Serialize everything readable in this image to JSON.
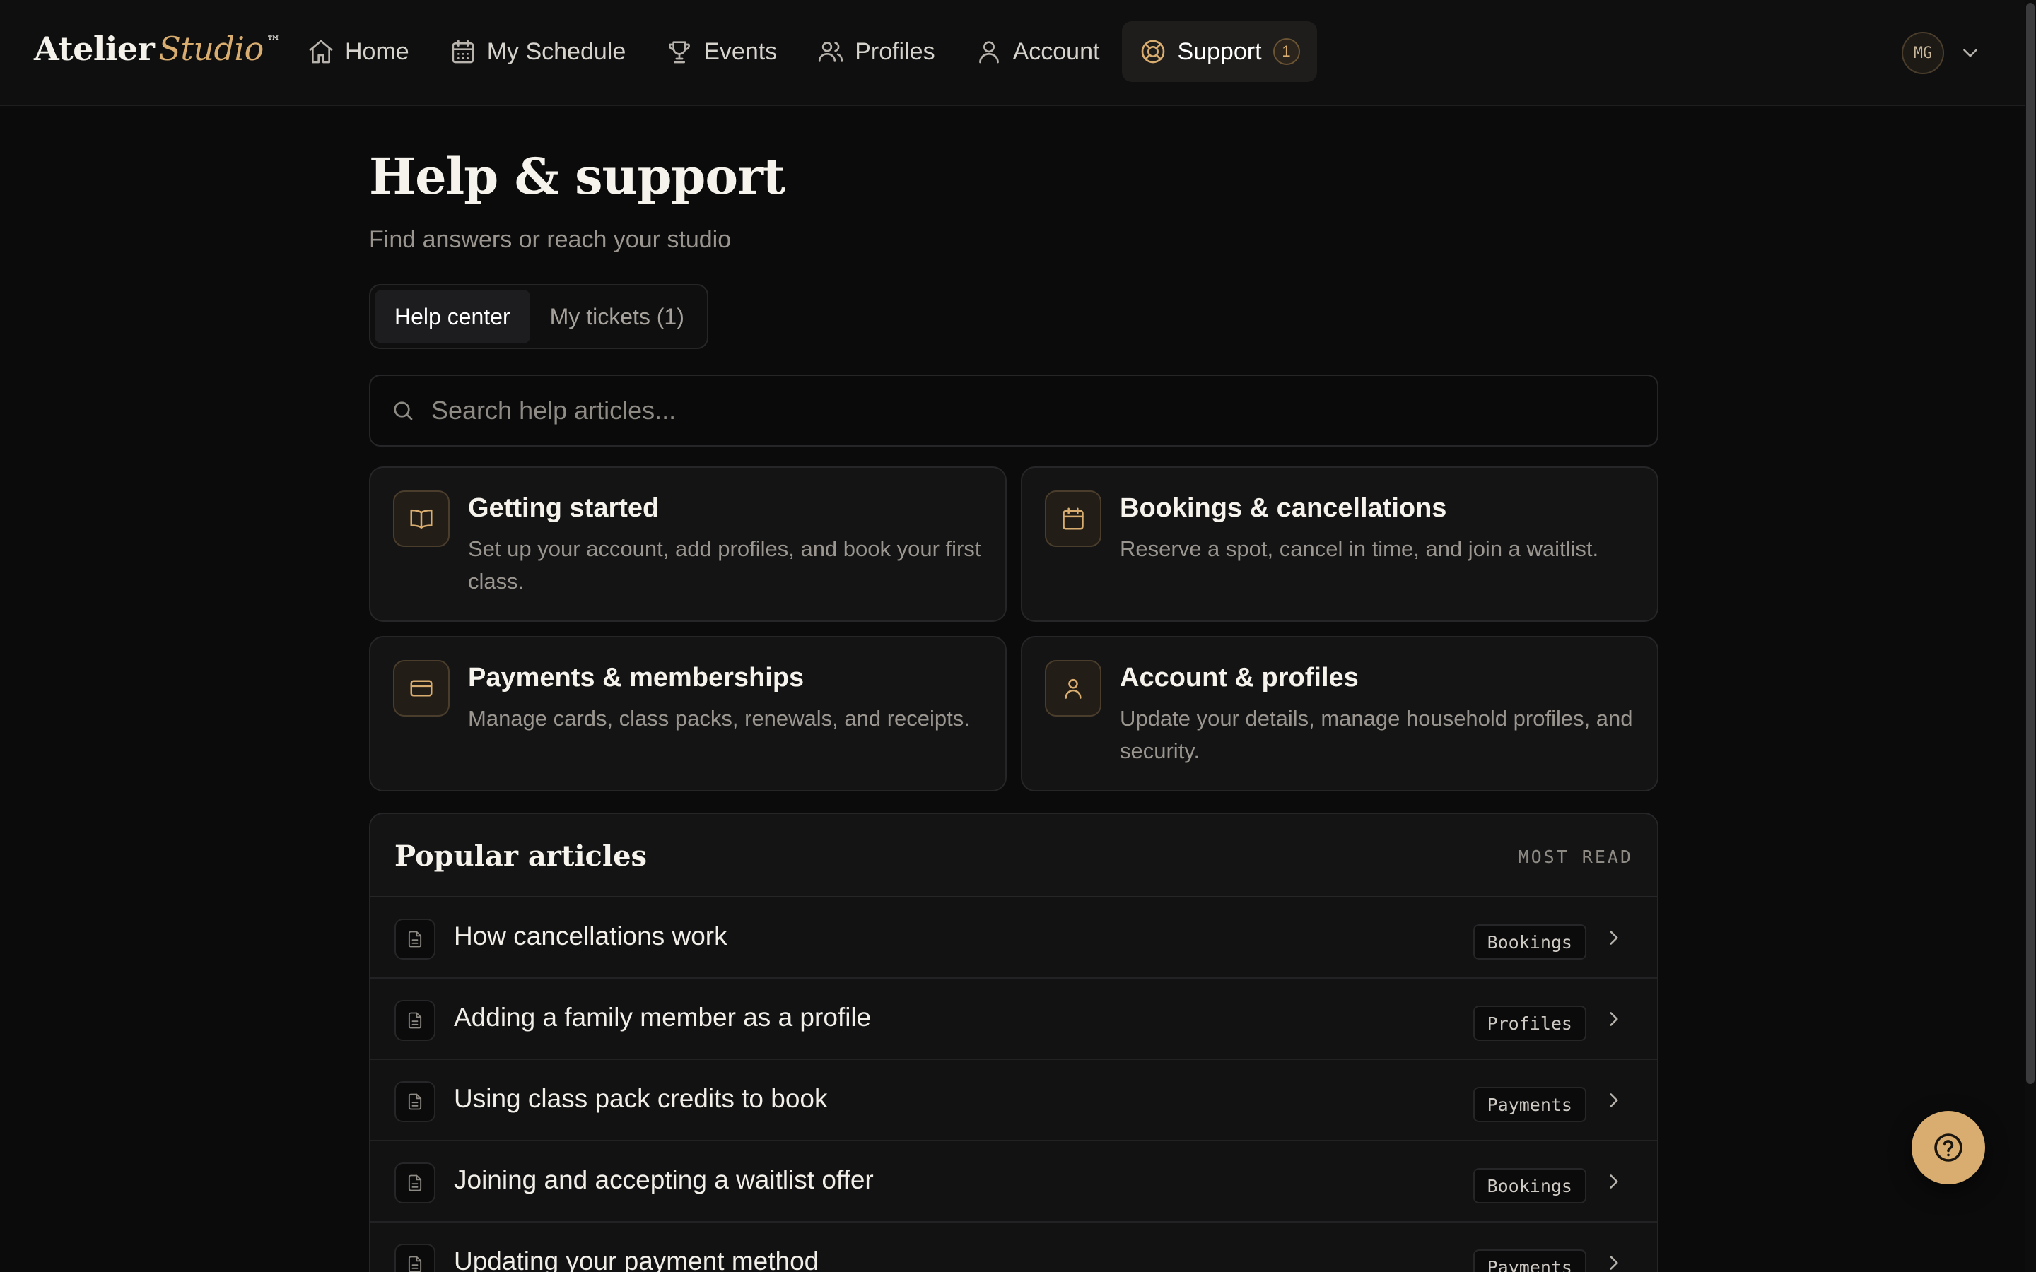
{
  "brand": {
    "name": "Atelier",
    "accent": "Studio",
    "mark": "™"
  },
  "nav": [
    {
      "label": "Home",
      "icon": "home-icon"
    },
    {
      "label": "My Schedule",
      "icon": "calendar-icon"
    },
    {
      "label": "Events",
      "icon": "trophy-icon"
    },
    {
      "label": "Profiles",
      "icon": "users-icon"
    },
    {
      "label": "Account",
      "icon": "user-icon"
    },
    {
      "label": "Support",
      "icon": "lifebuoy-icon",
      "badge": "1",
      "active": true
    }
  ],
  "user": {
    "initials": "MG"
  },
  "page": {
    "title": "Help & support",
    "subtitle": "Find answers or reach your studio"
  },
  "tabs": [
    {
      "label": "Help center",
      "active": true
    },
    {
      "label": "My tickets (1)",
      "active": false
    }
  ],
  "search": {
    "placeholder": "Search help articles...",
    "value": ""
  },
  "categories": [
    {
      "title": "Getting started",
      "description": "Set up your account, add profiles, and book your first class.",
      "icon": "book-open-icon"
    },
    {
      "title": "Bookings & cancellations",
      "description": "Reserve a spot, cancel in time, and join a waitlist.",
      "icon": "calendar-icon"
    },
    {
      "title": "Payments & memberships",
      "description": "Manage cards, class packs, renewals, and receipts.",
      "icon": "credit-card-icon"
    },
    {
      "title": "Account & profiles",
      "description": "Update your details, manage household profiles, and security.",
      "icon": "user-icon"
    }
  ],
  "articles": {
    "title": "Popular articles",
    "tag": "MOST READ",
    "items": [
      {
        "title": "How cancellations work",
        "tag": "Bookings"
      },
      {
        "title": "Adding a family member as a profile",
        "tag": "Profiles"
      },
      {
        "title": "Using class pack credits to book",
        "tag": "Payments"
      },
      {
        "title": "Joining and accepting a waitlist offer",
        "tag": "Bookings"
      },
      {
        "title": "Updating your payment method",
        "tag": "Payments"
      }
    ]
  },
  "colors": {
    "accent": "#d9ad6f",
    "background": "#0b0b0c",
    "surface": "#141415"
  }
}
